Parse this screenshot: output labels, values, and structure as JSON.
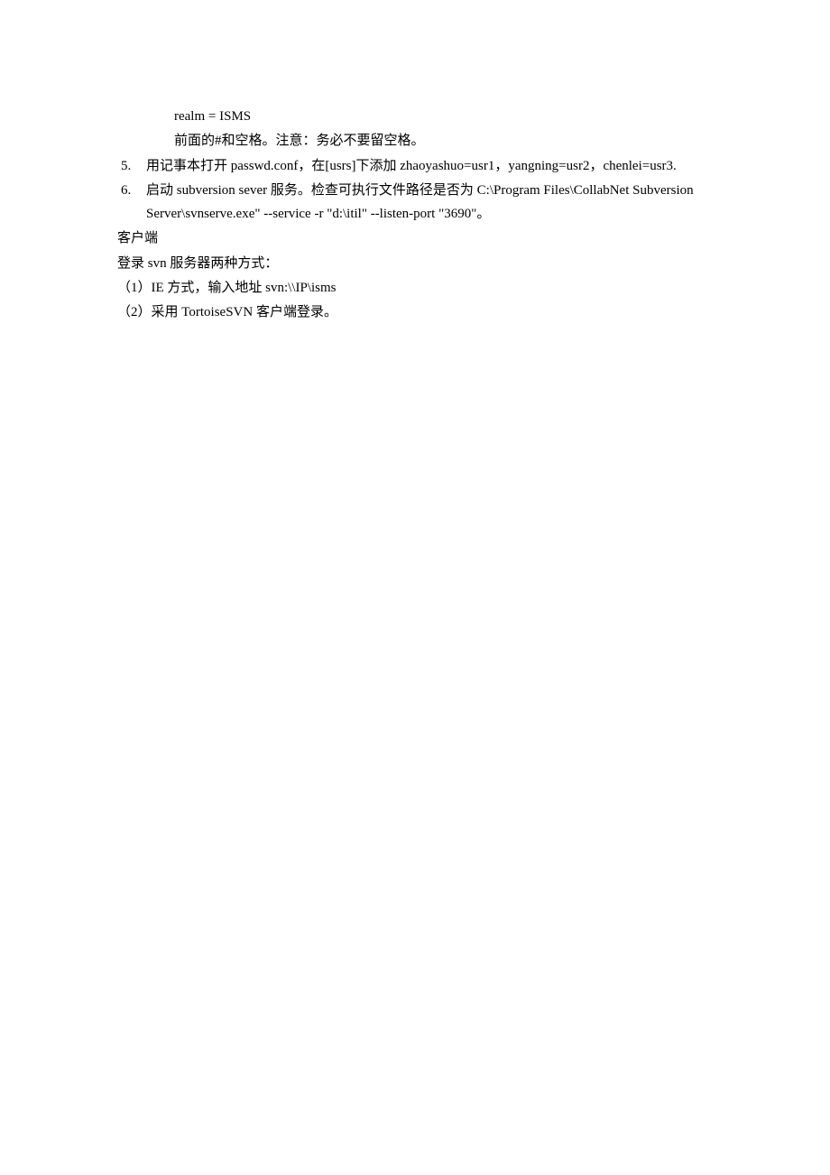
{
  "lines": {
    "realm": "realm = ISMS",
    "note_hash": "前面的#和空格。注意：务必不要留空格。"
  },
  "items": [
    {
      "marker": "5.",
      "text": "用记事本打开 passwd.conf，在[usrs]下添加 zhaoyashuo=usr1，yangning=usr2，chenlei=usr3."
    },
    {
      "marker": "6.",
      "text": "启动 subversion sever 服务。检查可执行文件路径是否为 C:\\Program Files\\CollabNet Subversion Server\\svnserve.exe\" --service -r \"d:\\itil\" --listen-port \"3690\"。"
    }
  ],
  "tail": {
    "client_heading": "客户端",
    "login_intro": "登录 svn 服务器两种方式：",
    "method1": "（1）IE 方式，输入地址 svn:\\\\IP\\isms",
    "method2": "（2）采用 TortoiseSVN 客户端登录。"
  }
}
